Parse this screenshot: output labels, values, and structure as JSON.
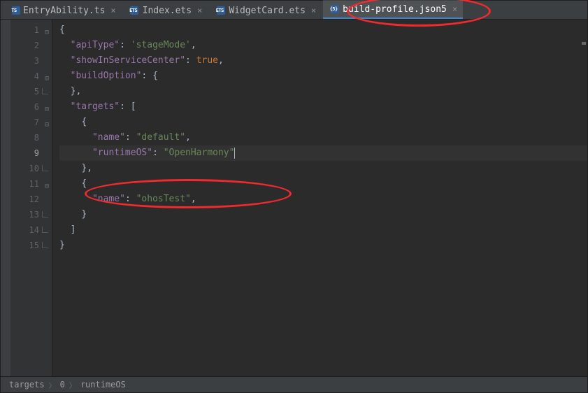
{
  "tabs": [
    {
      "label": "EntryAbility.ts",
      "icon": "ts",
      "active": false
    },
    {
      "label": "Index.ets",
      "icon": "ets",
      "active": false
    },
    {
      "label": "WidgetCard.ets",
      "icon": "ets",
      "active": false
    },
    {
      "label": "build-profile.json5",
      "icon": "json5",
      "active": true
    }
  ],
  "currentLine": 9,
  "gutter": {
    "count": 15
  },
  "code": {
    "lines": [
      {
        "ind": 0,
        "tok": [
          {
            "c": "brace",
            "t": "{"
          }
        ]
      },
      {
        "ind": 1,
        "tok": [
          {
            "c": "key",
            "t": "\"apiType\""
          },
          {
            "c": "punct",
            "t": ": "
          },
          {
            "c": "str",
            "t": "'stageMode'"
          },
          {
            "c": "punct",
            "t": ","
          }
        ]
      },
      {
        "ind": 1,
        "tok": [
          {
            "c": "key",
            "t": "\"showInServiceCenter\""
          },
          {
            "c": "punct",
            "t": ": "
          },
          {
            "c": "kw",
            "t": "true"
          },
          {
            "c": "punct",
            "t": ","
          }
        ]
      },
      {
        "ind": 1,
        "tok": [
          {
            "c": "key",
            "t": "\"buildOption\""
          },
          {
            "c": "punct",
            "t": ": "
          },
          {
            "c": "brace",
            "t": "{"
          }
        ]
      },
      {
        "ind": 1,
        "tok": [
          {
            "c": "brace",
            "t": "}"
          },
          {
            "c": "punct",
            "t": ","
          }
        ]
      },
      {
        "ind": 1,
        "tok": [
          {
            "c": "key",
            "t": "\"targets\""
          },
          {
            "c": "punct",
            "t": ": ["
          }
        ]
      },
      {
        "ind": 2,
        "tok": [
          {
            "c": "brace",
            "t": "{"
          }
        ]
      },
      {
        "ind": 3,
        "tok": [
          {
            "c": "key",
            "t": "\"name\""
          },
          {
            "c": "punct",
            "t": ": "
          },
          {
            "c": "str",
            "t": "\"default\""
          },
          {
            "c": "punct",
            "t": ","
          }
        ]
      },
      {
        "ind": 3,
        "tok": [
          {
            "c": "key",
            "t": "\"runtimeOS\""
          },
          {
            "c": "punct",
            "t": ": "
          },
          {
            "c": "str",
            "t": "\"OpenHarmony\""
          }
        ],
        "caret": true
      },
      {
        "ind": 2,
        "tok": [
          {
            "c": "brace",
            "t": "}"
          },
          {
            "c": "punct",
            "t": ","
          }
        ]
      },
      {
        "ind": 2,
        "tok": [
          {
            "c": "brace",
            "t": "{"
          }
        ]
      },
      {
        "ind": 3,
        "tok": [
          {
            "c": "key",
            "t": "\"name\""
          },
          {
            "c": "punct",
            "t": ": "
          },
          {
            "c": "str",
            "t": "\"ohosTest\""
          },
          {
            "c": "punct",
            "t": ","
          }
        ]
      },
      {
        "ind": 2,
        "tok": [
          {
            "c": "brace",
            "t": "}"
          }
        ]
      },
      {
        "ind": 1,
        "tok": [
          {
            "c": "punct",
            "t": "]"
          }
        ]
      },
      {
        "ind": 0,
        "tok": [
          {
            "c": "brace",
            "t": "}"
          }
        ]
      }
    ]
  },
  "gutterFold": {
    "open": [
      1,
      4,
      6,
      7,
      11
    ],
    "close": [
      5,
      10,
      13,
      14,
      15
    ]
  },
  "breadcrumb": [
    "targets",
    "0",
    "runtimeOS"
  ],
  "colors": {
    "accent": "#4083c9",
    "highlight": "#ef2b2f"
  },
  "icons": {
    "ts": "TS",
    "ets": "ETS",
    "json5": "{5}"
  }
}
